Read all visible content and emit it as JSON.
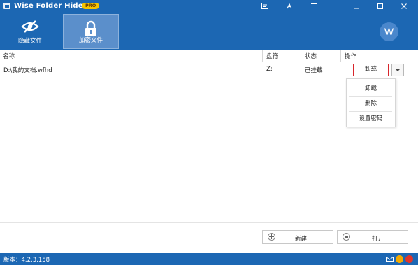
{
  "window": {
    "title": "Wise Folder Hider",
    "badge": "PRO"
  },
  "toolbar": {
    "hide_file_label": "隐藏文件",
    "encrypt_file_label": "加密文件",
    "avatar_letter": "W"
  },
  "table": {
    "headers": {
      "name": "名称",
      "drive": "盘符",
      "status": "状态",
      "action": "操作"
    },
    "rows": [
      {
        "name": "D:\\我的文档.wfhd",
        "drive": "Z:",
        "status": "已挂载",
        "action": "卸载"
      }
    ]
  },
  "dropdown_menu": {
    "items": [
      "卸载",
      "删除",
      "设置密码"
    ]
  },
  "footer": {
    "new_label": "新建",
    "open_label": "打开"
  },
  "statusbar": {
    "version": "版本：4.2.3.158"
  },
  "colors": {
    "primary": "#1c67b3",
    "active_tool": "#5b8fcb",
    "highlight_border": "#d8262c",
    "badge": "#f5c400"
  }
}
